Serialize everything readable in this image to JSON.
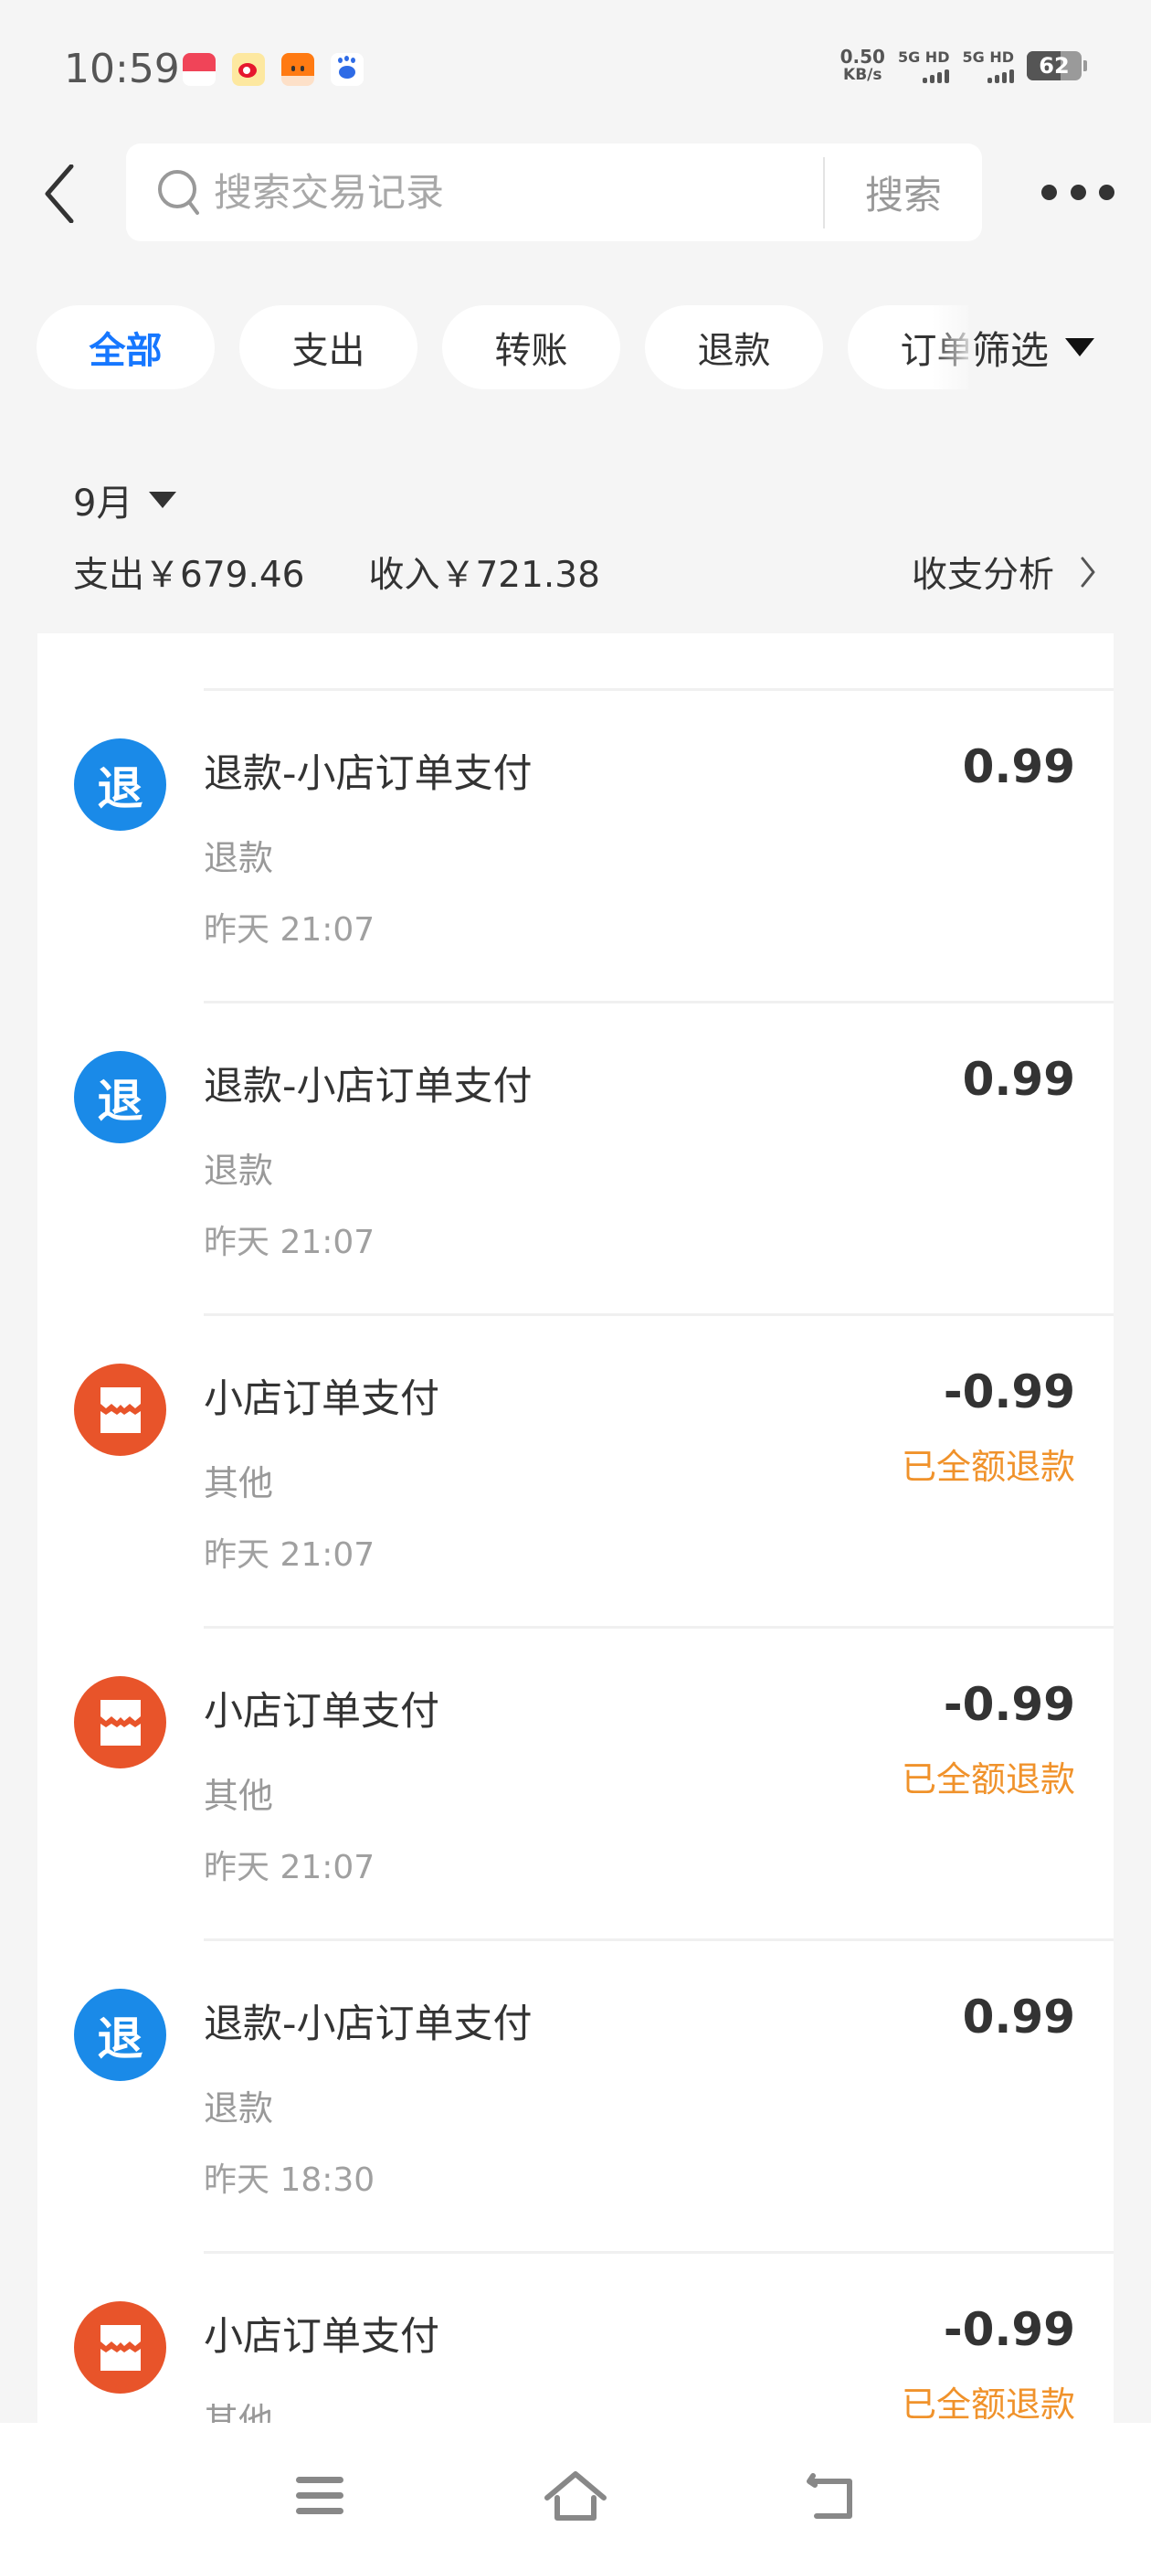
{
  "status_bar": {
    "time": "10:59",
    "notification_icons": [
      "wing-pay-icon",
      "weibo-icon",
      "fox-app-icon",
      "baidu-icon"
    ],
    "net_speed_value": "0.50",
    "net_speed_unit": "KB/s",
    "sim1_label": "5G HD",
    "sim2_label": "5G HD",
    "battery_level": "62",
    "battery_fraction": 0.62
  },
  "header": {
    "search_placeholder": "搜索交易记录",
    "search_button": "搜索"
  },
  "filters": {
    "chips": [
      {
        "label": "全部",
        "active": true
      },
      {
        "label": "支出",
        "active": false
      },
      {
        "label": "转账",
        "active": false
      },
      {
        "label": "退款",
        "active": false
      },
      {
        "label": "订单",
        "active": false
      }
    ],
    "filter_button": "筛选"
  },
  "summary": {
    "month": "9月",
    "expense": "支出￥679.46",
    "income": "收入￥721.38",
    "analysis_link": "收支分析"
  },
  "colors": {
    "accent": "#1677ff",
    "refund_icon": "#1a8ae8",
    "shop_icon": "#e8542a",
    "refunded_note": "#f0922b"
  },
  "transactions": [
    {
      "type": "refund",
      "icon_text": "退",
      "title": "退款-小店订单支付",
      "category": "退款",
      "time": "昨天 21:07",
      "amount": "0.99",
      "note": ""
    },
    {
      "type": "refund",
      "icon_text": "退",
      "title": "退款-小店订单支付",
      "category": "退款",
      "time": "昨天 21:07",
      "amount": "0.99",
      "note": ""
    },
    {
      "type": "shop",
      "icon_text": "",
      "title": "小店订单支付",
      "category": "其他",
      "time": "昨天 21:07",
      "amount": "-0.99",
      "note": "已全额退款"
    },
    {
      "type": "shop",
      "icon_text": "",
      "title": "小店订单支付",
      "category": "其他",
      "time": "昨天 21:07",
      "amount": "-0.99",
      "note": "已全额退款"
    },
    {
      "type": "refund",
      "icon_text": "退",
      "title": "退款-小店订单支付",
      "category": "退款",
      "time": "昨天 18:30",
      "amount": "0.99",
      "note": ""
    },
    {
      "type": "shop",
      "icon_text": "",
      "title": "小店订单支付",
      "category": "其他",
      "time": "",
      "amount": "-0.99",
      "note": "已全额退款"
    }
  ],
  "nav_bar": {
    "buttons": [
      "menu-icon",
      "home-icon",
      "back-icon"
    ]
  }
}
